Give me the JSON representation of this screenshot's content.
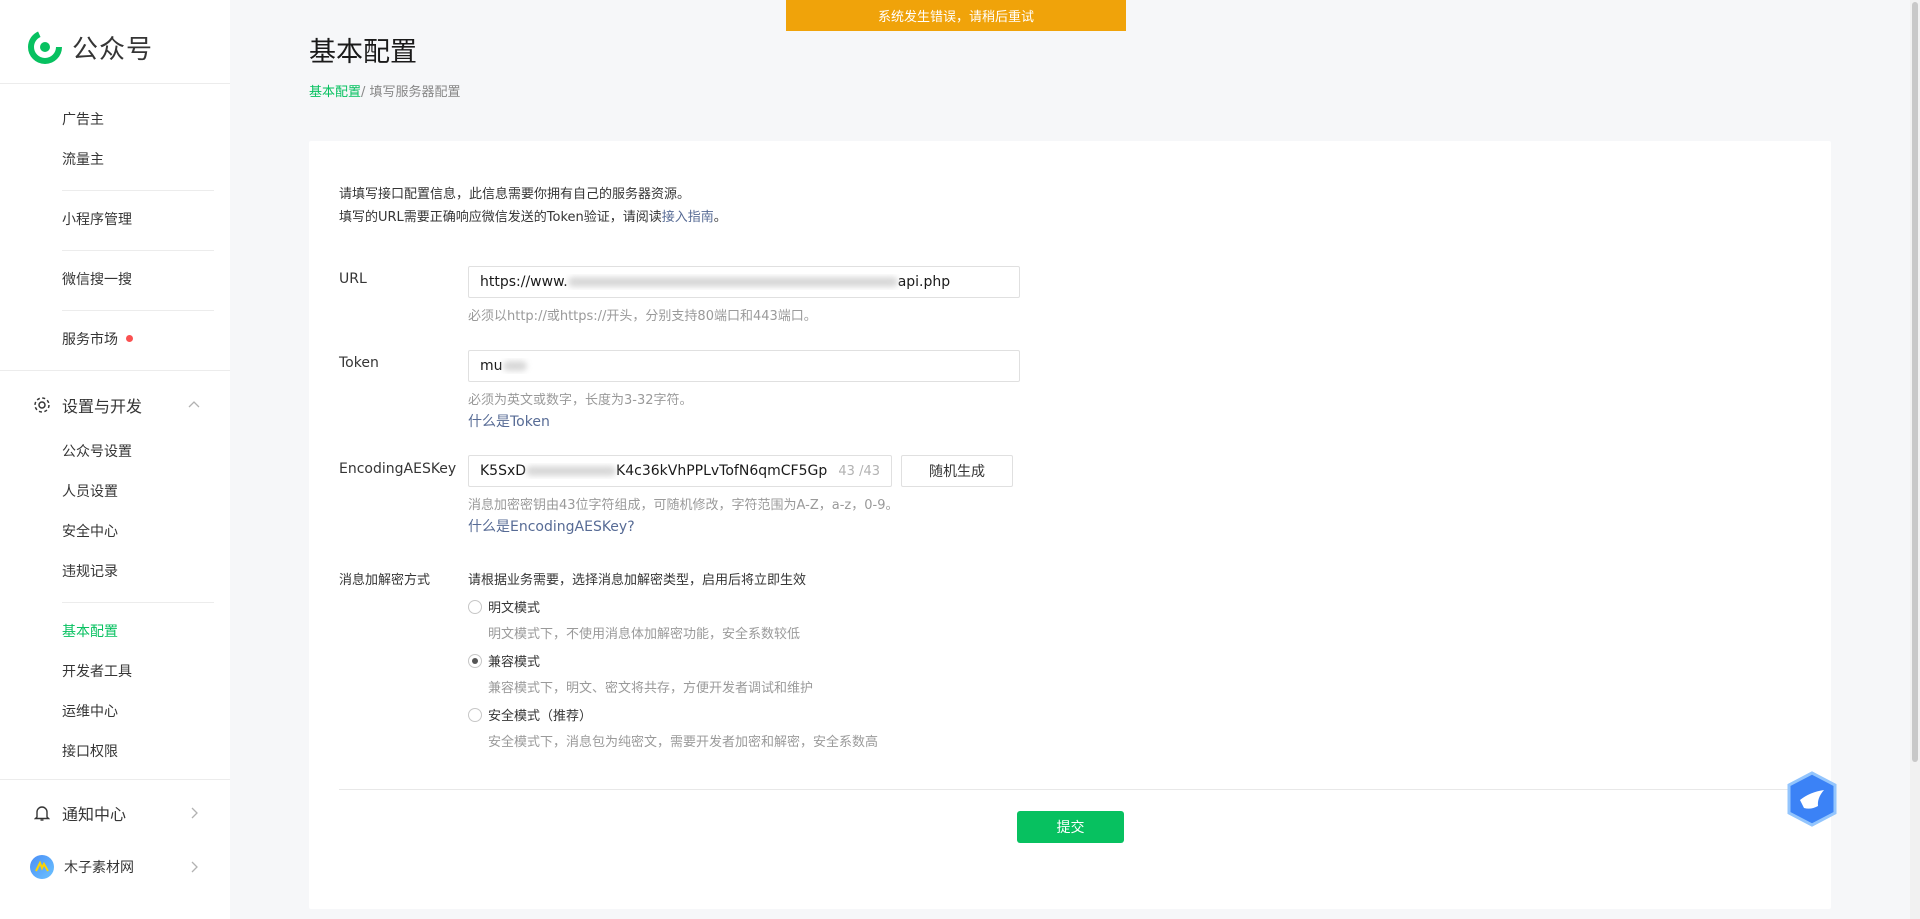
{
  "app": {
    "title": "公众号"
  },
  "banner": {
    "text": "系统发生错误，请稍后重试"
  },
  "sidebar": {
    "items_top": [
      {
        "label": "广告主"
      },
      {
        "label": "流量主"
      },
      {
        "label": "小程序管理"
      },
      {
        "label": "微信搜一搜"
      },
      {
        "label": "服务市场"
      }
    ],
    "settings_group": {
      "label": "设置与开发",
      "icon": "gear-icon",
      "expanded": true
    },
    "settings_items": [
      {
        "label": "公众号设置"
      },
      {
        "label": "人员设置"
      },
      {
        "label": "安全中心"
      },
      {
        "label": "违规记录"
      }
    ],
    "dev_items": [
      {
        "label": "基本配置",
        "active": true
      },
      {
        "label": "开发者工具"
      },
      {
        "label": "运维中心"
      },
      {
        "label": "接口权限"
      }
    ],
    "notify_group": {
      "label": "通知中心",
      "icon": "bell-icon"
    },
    "account": {
      "label": "木子素材网",
      "icon": "avatar"
    }
  },
  "page": {
    "title": "基本配置",
    "breadcrumb_link": "基本配置",
    "breadcrumb_current": "/ 填写服务器配置"
  },
  "intro": {
    "line1": "请填写接口配置信息，此信息需要你拥有自己的服务器资源。",
    "line2_prefix": "填写的URL需要正确响应微信发送的Token验证，请阅读",
    "line2_link": "接入指南",
    "line2_suffix": "。"
  },
  "form": {
    "url": {
      "label": "URL",
      "value_prefix": "https://www.",
      "value_suffix": "api.php",
      "hint": "必须以http://或https://开头，分别支持80端口和443端口。"
    },
    "token": {
      "label": "Token",
      "value_prefix": "mu",
      "hint": "必须为英文或数字，长度为3-32字符。",
      "help_link": "什么是Token"
    },
    "aeskey": {
      "label": "EncodingAESKey",
      "value_prefix": "K5SxD",
      "value_middle": "K4c36kVhPPLvTofN6qmCF5Gp",
      "counter": "43 /43",
      "generate_button": "随机生成",
      "hint": "消息加密密钥由43位字符组成，可随机修改，字符范围为A-Z，a-z，0-9。",
      "help_link": "什么是EncodingAESKey?"
    },
    "encryption": {
      "label": "消息加解密方式",
      "description": "请根据业务需要，选择消息加解密类型，启用后将立即生效",
      "options": [
        {
          "label": "明文模式",
          "desc": "明文模式下，不使用消息体加解密功能，安全系数较低",
          "checked": false
        },
        {
          "label": "兼容模式",
          "desc": "兼容模式下，明文、密文将共存，方便开发者调试和维护",
          "checked": true
        },
        {
          "label": "安全模式（推荐）",
          "desc": "安全模式下，消息包为纯密文，需要开发者加密和解密，安全系数高",
          "checked": false
        }
      ]
    },
    "submit_label": "提交"
  },
  "colors": {
    "accent": "#07c160",
    "banner": "#f0a30a",
    "link": "#576b95",
    "badge": "#fa5151"
  }
}
